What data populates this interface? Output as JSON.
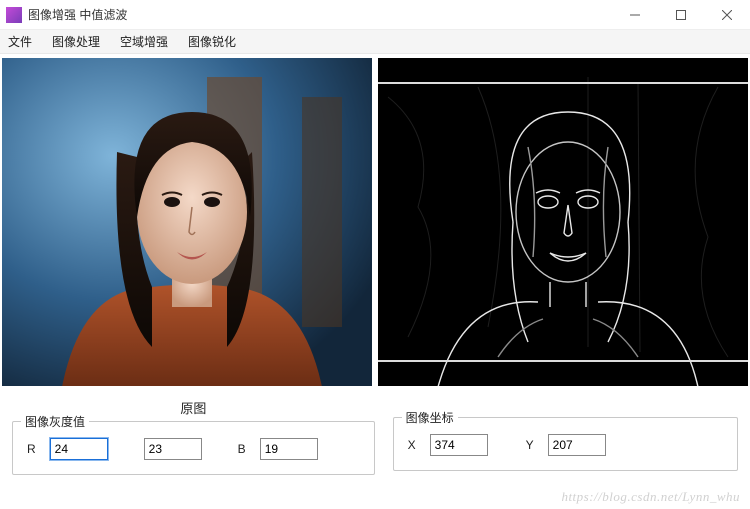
{
  "window": {
    "title": "图像增强 中值滤波",
    "buttons": {
      "min": "min",
      "max": "max",
      "close": "close"
    }
  },
  "menu": {
    "items": [
      "文件",
      "图像处理",
      "空域增强",
      "图像锐化"
    ]
  },
  "panels": {
    "left_title": "原图",
    "gray_group_label": "图像灰度值",
    "r_label": "R",
    "r_value": "24",
    "g_value": "23",
    "b_label": "B",
    "b_value": "19",
    "coord_group_label": "图像坐标",
    "x_label": "X",
    "x_value": "374",
    "y_label": "Y",
    "y_value": "207"
  },
  "watermark": "https://blog.csdn.net/Lynn_whu"
}
